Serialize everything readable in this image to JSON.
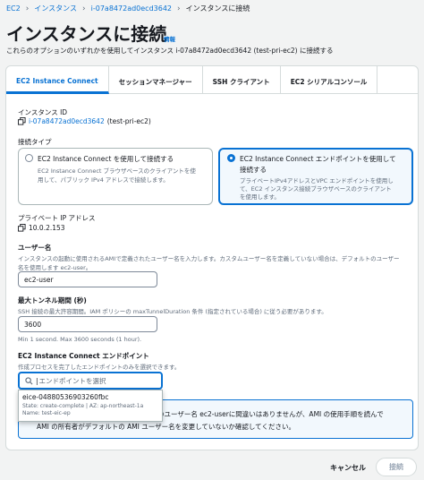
{
  "breadcrumb": {
    "ec2": "EC2",
    "instances": "インスタンス",
    "instance_id": "i-07a8472ad0ecd3642",
    "current": "インスタンスに接続"
  },
  "page": {
    "title": "インスタンスに接続",
    "info_link": "情報",
    "subtitle": "これらのオプションのいずれかを使用してインスタンス i-07a8472ad0ecd3642 (test-pri-ec2) に接続する"
  },
  "tabs": [
    {
      "label": "EC2 Instance Connect"
    },
    {
      "label": "セッションマネージャー"
    },
    {
      "label": "SSH クライアント"
    },
    {
      "label": "EC2 シリアルコンソール"
    }
  ],
  "instance": {
    "label": "インスタンス ID",
    "id_link": "i-07a8472ad0ecd3642",
    "name": "(test-pri-ec2)"
  },
  "connection_type": {
    "label": "接続タイプ",
    "option1": {
      "title": "EC2 Instance Connect を使用して接続する",
      "desc1": "EC2 Instance Connect ブラウザベースのクライアントを使",
      "desc2": "用して、パブリック IPv4 アドレスで接続します。"
    },
    "option2": {
      "title1": "EC2 Instance Connect エンドポイントを使用して",
      "title2": "接続する",
      "desc1": "プライベートIPv4アドレスとVPC エンドポイントを使用し",
      "desc2": "て、EC2 インスタンス接続ブラウザベースのクライアント",
      "desc3": "を使用します。"
    }
  },
  "private_ip": {
    "label": "プライベート IP アドレス",
    "value": "10.0.2.153"
  },
  "username": {
    "label": "ユーザー名",
    "desc1": "インスタンスの起動に使用されるAMIで定義されたユーザー名を入力します。カスタムユーザー名を定義していない場合は、デフォルトのユーザー",
    "desc2": "名を使用します ec2-user。",
    "value": "ec2-user"
  },
  "tunnel": {
    "label": "最大トンネル期間 (秒)",
    "desc": "SSH 接続の最大許容期間。IAM ポリシーの maxTunnelDuration 条件 (指定されている場合) に従う必要があります。",
    "value": "3600",
    "hint": "Min 1 second. Max 3600 seconds (1 hour)."
  },
  "endpoint": {
    "label": "EC2 Instance Connect エンドポイント",
    "desc": "作成プロセスを完了したエンドポイントのみを選択できます。",
    "placeholder": "エンドポイントを選択",
    "option": {
      "id": "eice-04880536903260fbc",
      "state": "State: create-complete | AZ: ap-northeast-1a",
      "name": "Name: test-eic-ep"
    }
  },
  "alert": {
    "line1": "のユーザー名 ec2-userに間違いはありませんが、AMI の使用手順を読んで",
    "line2": "AMI の所有者がデフォルトの AMI ユーザー名を変更していないか確認してください。"
  },
  "footer": {
    "cancel": "キャンセル",
    "connect": "接続"
  },
  "colors": {
    "accent": "#0972d3",
    "text": "#16191f",
    "muted": "#5f6b7a",
    "border": "#d5dbdb"
  }
}
